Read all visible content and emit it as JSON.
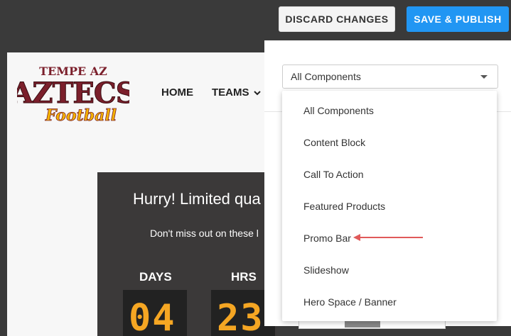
{
  "topbar": {
    "discard_label": "DISCARD CHANGES",
    "publish_label": "SAVE & PUBLISH",
    "publish_color": "#2196f3"
  },
  "site": {
    "logo": {
      "line1": "TEMPE AZ",
      "line2": "AZTECS",
      "line3": "Football",
      "primary_color": "#7b1f2b",
      "accent_color": "#f5b400"
    },
    "nav": [
      {
        "label": "HOME"
      },
      {
        "label": "TEAMS"
      }
    ],
    "promo": {
      "title": "Hurry! Limited qua",
      "subtitle": "Don't miss out on these l",
      "countdown": [
        {
          "label": "DAYS",
          "value": "04"
        },
        {
          "label": "HRS",
          "value": "23"
        }
      ],
      "digit_color": "#f5a623"
    }
  },
  "panel": {
    "select": {
      "value": "All Components",
      "icon": "caret-down-icon"
    },
    "options": [
      "All Components",
      "Content Block",
      "Call To Action",
      "Featured Products",
      "Promo Bar",
      "Slideshow",
      "Hero Space / Banner"
    ],
    "highlighted_option": "Promo Bar",
    "annotation_color": "#e05a5a"
  }
}
